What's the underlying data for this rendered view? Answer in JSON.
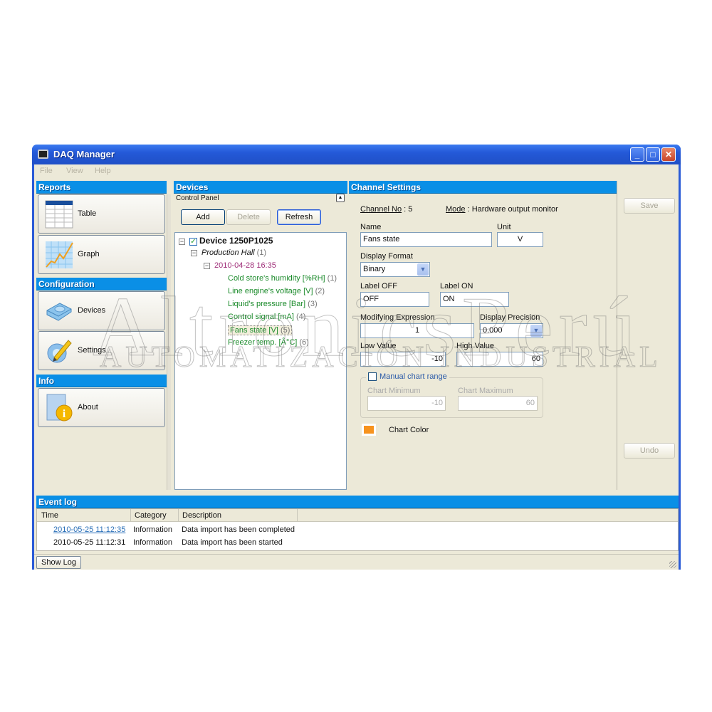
{
  "window": {
    "title": "DAQ Manager",
    "controls": {
      "minimize": "_",
      "maximize": "□",
      "close": "✕"
    }
  },
  "menu": [
    "File",
    "View",
    "Help"
  ],
  "sidebar": {
    "sections": [
      {
        "title": "Reports",
        "items": [
          {
            "label": "Table",
            "icon": "table-icon"
          },
          {
            "label": "Graph",
            "icon": "graph-icon"
          }
        ]
      },
      {
        "title": "Configuration",
        "items": [
          {
            "label": "Devices",
            "icon": "devices-icon"
          },
          {
            "label": "Settings",
            "icon": "settings-icon"
          }
        ]
      },
      {
        "title": "Info",
        "items": [
          {
            "label": "About",
            "icon": "info-icon"
          }
        ]
      }
    ]
  },
  "devices": {
    "title": "Devices",
    "control_panel": "Control Panel",
    "buttons": {
      "add": "Add",
      "delete": "Delete",
      "refresh": "Refresh"
    },
    "tree": {
      "device": "Device 1250P1025",
      "device_checked": true,
      "location": "Production Hall",
      "location_count": "(1)",
      "session": "2010-04-28 16:35",
      "channels": [
        {
          "name": "Cold store's humidity [%RH]",
          "num": "(1)"
        },
        {
          "name": "Line engine's voltage [V]",
          "num": "(2)"
        },
        {
          "name": "Liquid's pressure [Bar]",
          "num": "(3)"
        },
        {
          "name": "Control signal [mA]",
          "num": "(4)"
        },
        {
          "name": "Fans state [V]",
          "num": "(5)",
          "selected": true
        },
        {
          "name": "Freezer temp. [Â°C]",
          "num": "(6)"
        }
      ]
    }
  },
  "channel_settings": {
    "title": "Channel Settings",
    "channel_no_label": "Channel No",
    "channel_no": "5",
    "mode_label": "Mode",
    "mode": "Hardware output monitor",
    "name_label": "Name",
    "name_value": "Fans state",
    "unit_label": "Unit",
    "unit_value": "V",
    "display_format_label": "Display Format",
    "display_format_value": "Binary",
    "label_off_label": "Label OFF",
    "label_off_value": "OFF",
    "label_on_label": "Label ON",
    "label_on_value": "ON",
    "modifying_expression_label": "Modifying Expression",
    "modifying_expression_value": "1",
    "display_precision_label": "Display Precision",
    "display_precision_value": "0.000",
    "low_value_label": "Low Value",
    "low_value": "-10",
    "high_value_label": "High Value",
    "high_value": "60",
    "manual_chart_range_label": "Manual chart range",
    "manual_chart_range_checked": false,
    "chart_minimum_label": "Chart Minimum",
    "chart_minimum_value": "-10",
    "chart_maximum_label": "Chart Maximum",
    "chart_maximum_value": "60",
    "chart_color_label": "Chart Color",
    "chart_color": "#f7931e"
  },
  "actions": {
    "save": "Save",
    "undo": "Undo"
  },
  "event_log": {
    "title": "Event log",
    "columns": [
      "Time",
      "Category",
      "Description"
    ],
    "rows": [
      {
        "time": "2010-05-25 11:12:35",
        "category": "Information",
        "description": "Data import has been completed"
      },
      {
        "time": "2010-05-25 11:12:31",
        "category": "Information",
        "description": "Data import has been started"
      }
    ],
    "show_log_button": "Show Log"
  },
  "watermark": {
    "line1": "AltronicsPerú",
    "line2": "AUTOMATIZACIÓN INDUSTRIAL"
  },
  "colors": {
    "section_header": "#0a8fe6",
    "title_bar": "#2459d8",
    "session_text": "#a0307a",
    "channel_text": "#1a8a2a",
    "link": "#2a6fb8"
  }
}
